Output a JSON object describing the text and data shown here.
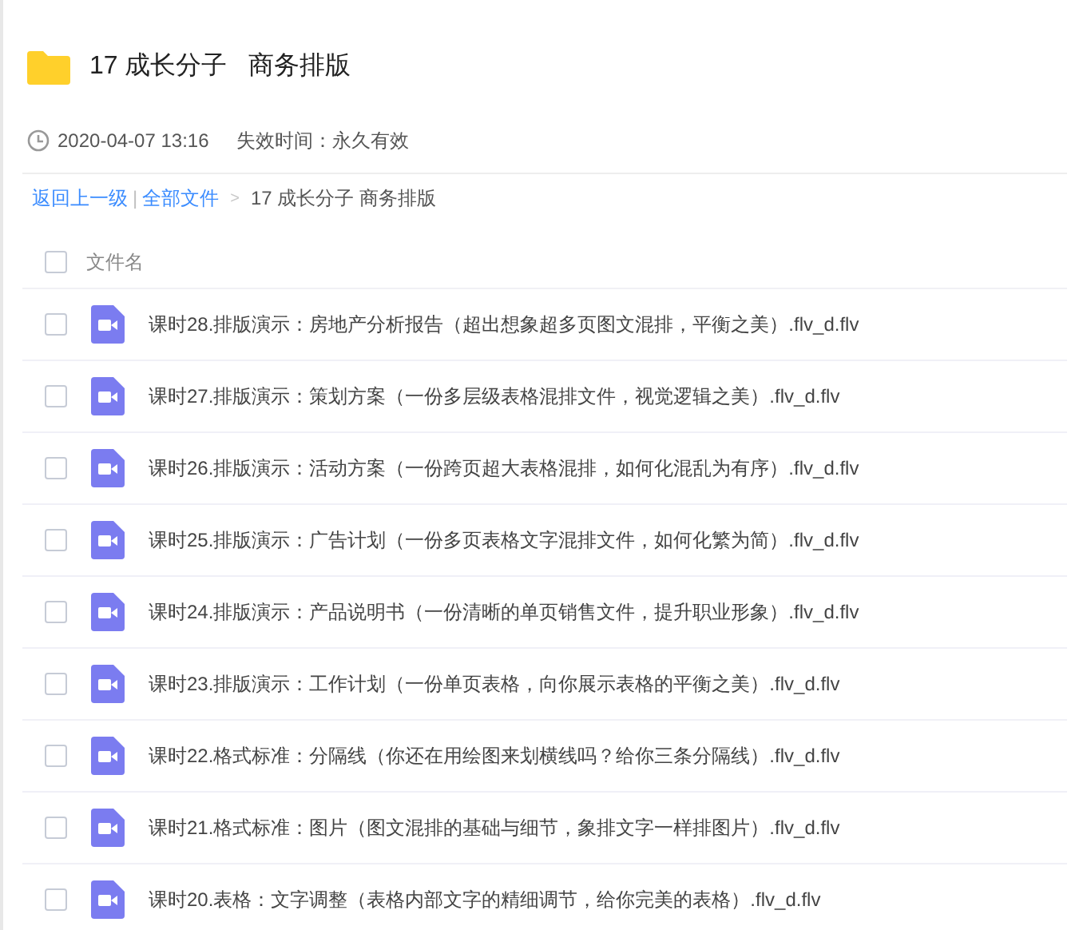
{
  "folder": {
    "title": "17 成长分子   商务排版",
    "date": "2020-04-07 13:16",
    "expiry": "失效时间：永久有效"
  },
  "breadcrumb": {
    "back": "返回上一级",
    "separator": "|",
    "root": "全部文件",
    "arrow": ">",
    "current": "17 成长分子 商务排版"
  },
  "table": {
    "header": {
      "label": "文件名",
      "checked": false
    },
    "rows": [
      {
        "name": "课时28.排版演示：房地产分析报告（超出想象超多页图文混排，平衡之美）.flv_d.flv",
        "checked": false
      },
      {
        "name": "课时27.排版演示：策划方案（一份多层级表格混排文件，视觉逻辑之美）.flv_d.flv",
        "checked": false
      },
      {
        "name": "课时26.排版演示：活动方案（一份跨页超大表格混排，如何化混乱为有序）.flv_d.flv",
        "checked": false
      },
      {
        "name": "课时25.排版演示：广告计划（一份多页表格文字混排文件，如何化繁为简）.flv_d.flv",
        "checked": false
      },
      {
        "name": "课时24.排版演示：产品说明书（一份清晰的单页销售文件，提升职业形象）.flv_d.flv",
        "checked": false
      },
      {
        "name": "课时23.排版演示：工作计划（一份单页表格，向你展示表格的平衡之美）.flv_d.flv",
        "checked": false
      },
      {
        "name": "课时22.格式标准：分隔线（你还在用绘图来划横线吗？给你三条分隔线）.flv_d.flv",
        "checked": false
      },
      {
        "name": "课时21.格式标准：图片（图文混排的基础与细节，象排文字一样排图片）.flv_d.flv",
        "checked": false
      },
      {
        "name": "课时20.表格：文字调整（表格内部文字的精细调节，给你完美的表格）.flv_d.flv",
        "checked": false
      }
    ]
  }
}
